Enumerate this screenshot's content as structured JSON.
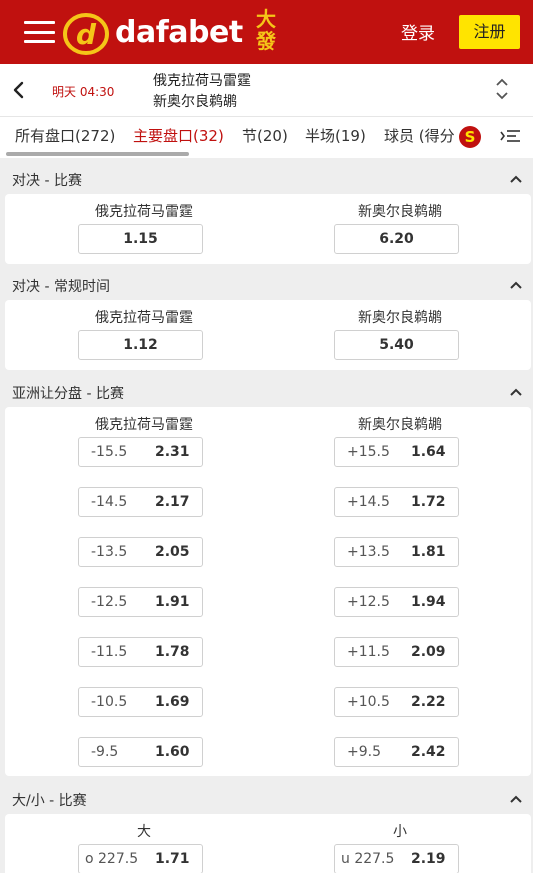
{
  "header": {
    "logo_text": "dafabet",
    "logo_cn": "大發",
    "login_label": "登录",
    "register_label": "注册"
  },
  "match": {
    "time": "明天 04:30",
    "team1": "俄克拉荷马雷霆",
    "team2": "新奥尔良鹈鹕"
  },
  "tabs": [
    {
      "label": "所有盘口(272)"
    },
    {
      "label": "主要盘口(32)"
    },
    {
      "label": "节(20)"
    },
    {
      "label": "半场(19)"
    },
    {
      "label": "球员 (得分"
    }
  ],
  "tabs_badge": "S",
  "sections": [
    {
      "title": "对决 - 比赛",
      "home": "俄克拉荷马雷霆",
      "away": "新奥尔良鹈鹕",
      "home_odds": "1.15",
      "away_odds": "6.20"
    },
    {
      "title": "对决 - 常规时间",
      "home": "俄克拉荷马雷霆",
      "away": "新奥尔良鹈鹕",
      "home_odds": "1.12",
      "away_odds": "5.40"
    },
    {
      "title": "亚洲让分盘 - 比赛",
      "home": "俄克拉荷马雷霆",
      "away": "新奥尔良鹈鹕",
      "rows": [
        {
          "home_line": "-15.5",
          "home_odds": "2.31",
          "away_line": "+15.5",
          "away_odds": "1.64"
        },
        {
          "home_line": "-14.5",
          "home_odds": "2.17",
          "away_line": "+14.5",
          "away_odds": "1.72"
        },
        {
          "home_line": "-13.5",
          "home_odds": "2.05",
          "away_line": "+13.5",
          "away_odds": "1.81"
        },
        {
          "home_line": "-12.5",
          "home_odds": "1.91",
          "away_line": "+12.5",
          "away_odds": "1.94"
        },
        {
          "home_line": "-11.5",
          "home_odds": "1.78",
          "away_line": "+11.5",
          "away_odds": "2.09"
        },
        {
          "home_line": "-10.5",
          "home_odds": "1.69",
          "away_line": "+10.5",
          "away_odds": "2.22"
        },
        {
          "home_line": "-9.5",
          "home_odds": "1.60",
          "away_line": "+9.5",
          "away_odds": "2.42"
        }
      ]
    },
    {
      "title": "大/小 - 比赛",
      "home": "大",
      "away": "小",
      "home_line": "o 227.5",
      "home_odds": "1.71",
      "away_line": "u 227.5",
      "away_odds": "2.19"
    }
  ],
  "colors": {
    "brand_red": "#c0110f",
    "register_yellow": "#ffe400",
    "logo_gold": "#f5c518"
  }
}
